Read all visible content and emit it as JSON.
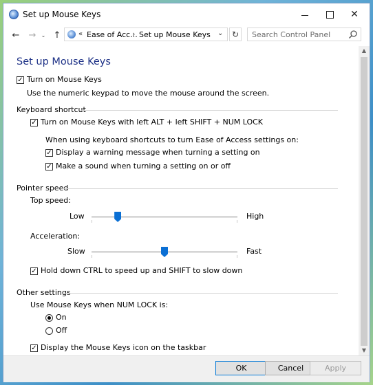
{
  "window": {
    "title": "Set up Mouse Keys"
  },
  "titlebar": {
    "minimize": "minimize",
    "maximize": "maximize",
    "close": "✕"
  },
  "nav": {
    "back": "←",
    "forward": "→",
    "recent": "⌄",
    "up": "↑",
    "chevrons": "«",
    "breadcrumb": [
      "Ease of Acc...",
      "Set up Mouse Keys"
    ],
    "separator": "›",
    "dropdown": "⌄",
    "refresh": "↻"
  },
  "search": {
    "placeholder": "Search Control Panel"
  },
  "page": {
    "title": "Set up Mouse Keys",
    "turn_on_label": "Turn on Mouse Keys",
    "turn_on_checked": true,
    "turn_on_desc": "Use the numeric keypad to move the mouse around the screen."
  },
  "keyboard_shortcut": {
    "heading": "Keyboard shortcut",
    "shortcut_label": "Turn on Mouse Keys with left ALT + left SHIFT + NUM LOCK",
    "shortcut_checked": true,
    "when_using": "When using keyboard shortcuts to turn Ease of Access settings on:",
    "warning_label": "Display a warning message when turning a setting on",
    "warning_checked": true,
    "sound_label": "Make a sound when turning a setting on or off",
    "sound_checked": true
  },
  "pointer_speed": {
    "heading": "Pointer speed",
    "top_speed_label": "Top speed:",
    "top_low": "Low",
    "top_high": "High",
    "top_speed_value": 0.18,
    "acceleration_label": "Acceleration:",
    "acc_slow": "Slow",
    "acc_fast": "Fast",
    "acceleration_value": 0.5,
    "ctrl_label": "Hold down CTRL to speed up and SHIFT to slow down",
    "ctrl_checked": true
  },
  "other_settings": {
    "heading": "Other settings",
    "numlock_label": "Use Mouse Keys when NUM LOCK is:",
    "on_label": "On",
    "off_label": "Off",
    "selected": "On",
    "taskbar_label": "Display the Mouse Keys icon on the taskbar",
    "taskbar_checked": true
  },
  "footer": {
    "ok": "OK",
    "cancel": "Cancel",
    "apply": "Apply"
  },
  "check_glyph": "✓"
}
